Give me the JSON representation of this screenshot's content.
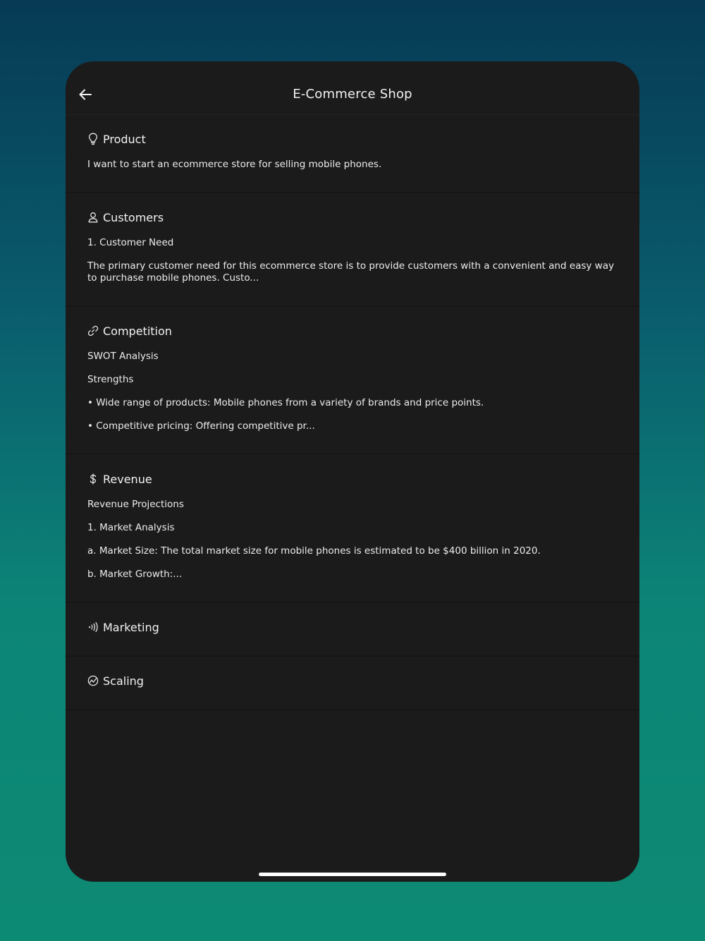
{
  "header": {
    "title": "E-Commerce Shop"
  },
  "sections": {
    "product": {
      "title": "Product",
      "lines": [
        "I want to start an ecommerce store for selling mobile phones."
      ]
    },
    "customers": {
      "title": "Customers",
      "lines": [
        "1. Customer Need",
        "The primary customer need for this ecommerce store is to provide customers with a convenient and easy way to purchase mobile phones. Custo..."
      ]
    },
    "competition": {
      "title": "Competition",
      "lines": [
        "SWOT Analysis",
        "Strengths",
        "• Wide range of products: Mobile phones from a variety of brands and price points.",
        "• Competitive pricing: Offering competitive pr..."
      ]
    },
    "revenue": {
      "title": "Revenue",
      "lines": [
        "Revenue Projections",
        "1. Market Analysis",
        "a. Market Size: The total market size for mobile phones is estimated to be $400 billion in 2020.",
        "b. Market Growth:..."
      ]
    },
    "marketing": {
      "title": "Marketing"
    },
    "scaling": {
      "title": "Scaling"
    }
  }
}
